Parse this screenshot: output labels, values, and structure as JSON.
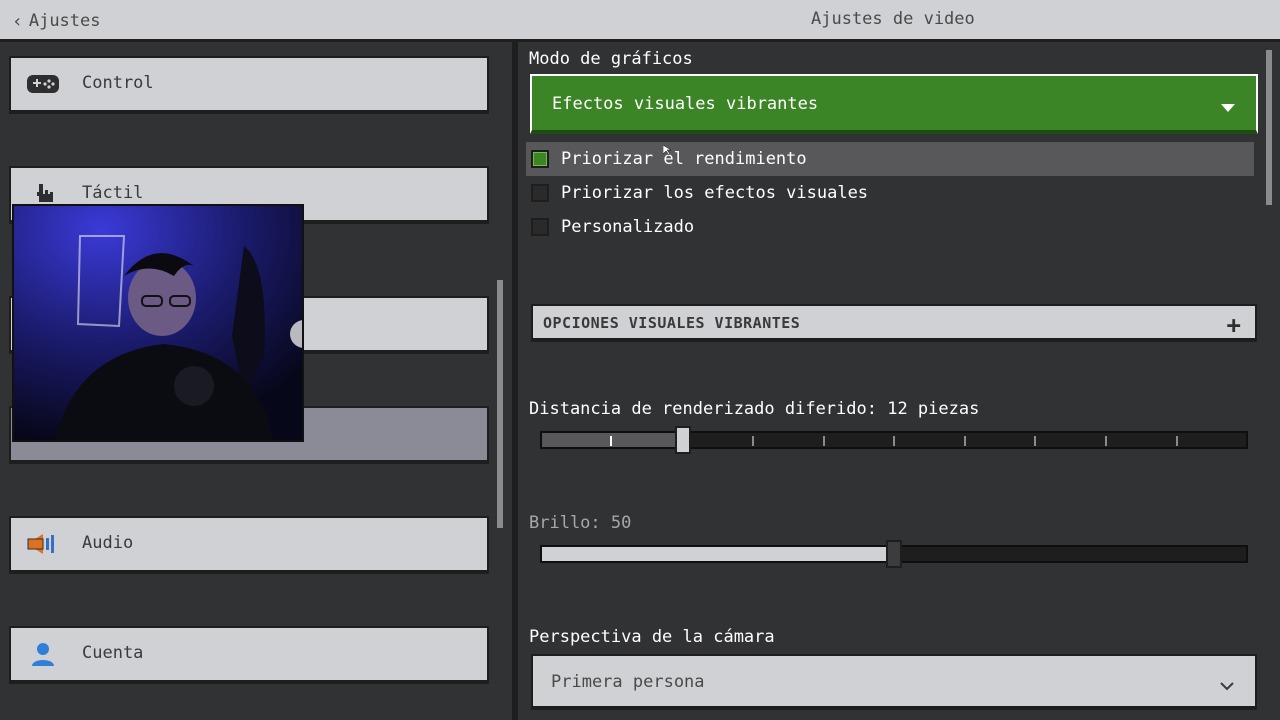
{
  "topbar": {
    "back_label": "Ajustes",
    "title": "Ajustes de video"
  },
  "sidebar": {
    "items": [
      {
        "label": "Control",
        "icon": "gamepad-icon"
      },
      {
        "label": "Táctil",
        "icon": "touch-hand-icon"
      },
      {
        "label": "",
        "icon": "unknown-icon"
      },
      {
        "label": "",
        "icon": "unknown-icon",
        "selected": true
      },
      {
        "label": "Audio",
        "icon": "speaker-icon"
      },
      {
        "label": "Cuenta",
        "icon": "person-icon"
      }
    ]
  },
  "video": {
    "graphics_mode_label": "Modo de gráficos",
    "graphics_mode_value": "Efectos visuales vibrantes",
    "options": [
      {
        "label": "Priorizar el rendimiento",
        "checked": true
      },
      {
        "label": "Priorizar los efectos visuales",
        "checked": false
      },
      {
        "label": "Personalizado",
        "checked": false
      }
    ],
    "vibrant_section_label": "OPCIONES VISUALES VIBRANTES",
    "render_distance_label": "Distancia de renderizado diferido: 12 piezas",
    "render_distance_fraction": 0.2,
    "brightness_label": "Brillo: 50",
    "brightness_value": 50,
    "camera_label": "Perspectiva de la cámara",
    "camera_value": "Primera persona"
  },
  "colors": {
    "accent_green": "#3c8527",
    "button_gray": "#d0d1d4",
    "background": "#313233"
  }
}
